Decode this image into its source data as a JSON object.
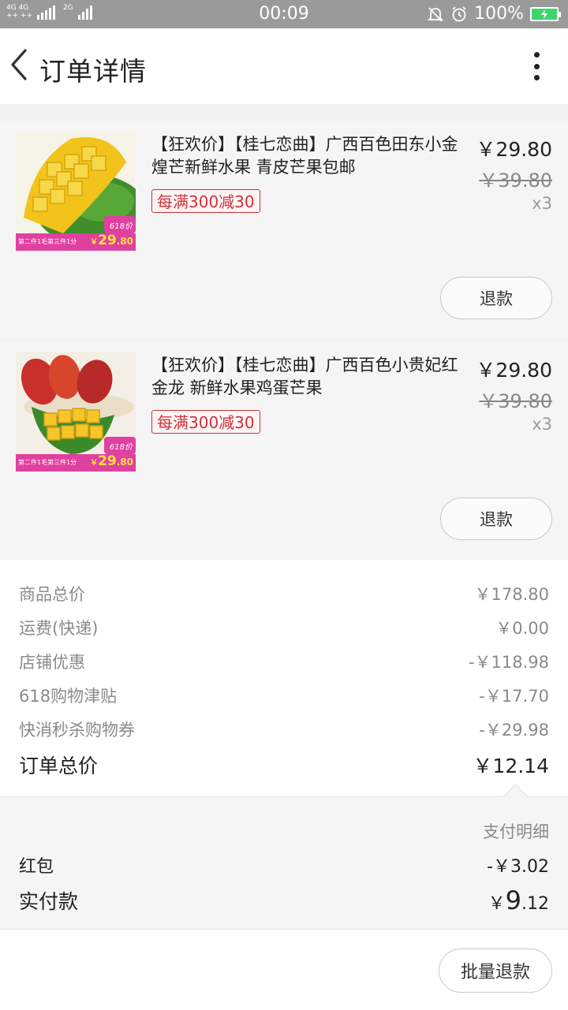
{
  "status_bar": {
    "network_left": "4G 4G",
    "network_left_sub": "++ ++",
    "network_right": "2G",
    "time": "00:09",
    "battery": "100%"
  },
  "header": {
    "title": "订单详情",
    "back_icon": "chevron-left-icon",
    "more_icon": "more-vertical-icon"
  },
  "products": [
    {
      "title": "【狂欢价】【桂七恋曲】广西百色田东小金煌芒新鲜水果 青皮芒果包邮",
      "promo": "每满300减30",
      "price": "￥29.80",
      "original_price": "￥39.80",
      "quantity": "x3",
      "refund_label": "退款",
      "thumb": {
        "badge": "618价",
        "banner": "第二件1毛第三件1分",
        "banner_price_cur": "￥",
        "banner_price_int": "29",
        "banner_price_dec": ".80"
      }
    },
    {
      "title": "【狂欢价】【桂七恋曲】广西百色小贵妃红金龙 新鲜水果鸡蛋芒果",
      "promo": "每满300减30",
      "price": "￥29.80",
      "original_price": "￥39.80",
      "quantity": "x3",
      "refund_label": "退款",
      "thumb": {
        "badge": "618价",
        "banner": "第二件1毛第三件1分",
        "banner_price_cur": "￥",
        "banner_price_int": "29",
        "banner_price_dec": ".80"
      }
    }
  ],
  "summary": [
    {
      "label": "商品总价",
      "value": "￥178.80"
    },
    {
      "label": "运费(快递)",
      "value": "￥0.00"
    },
    {
      "label": "店铺优惠",
      "value": "-￥118.98"
    },
    {
      "label": "618购物津贴",
      "value": "-￥17.70"
    },
    {
      "label": "快消秒杀购物券",
      "value": "-￥29.98"
    }
  ],
  "order_total": {
    "label": "订单总价",
    "value": "￥12.14"
  },
  "payment": {
    "detail_link": "支付明细",
    "red_packet_label": "红包",
    "red_packet_value": "-￥3.02",
    "actual_label": "实付款",
    "actual_cur": "￥",
    "actual_int": "9",
    "actual_dec": ".12"
  },
  "batch_refund_label": "批量退款",
  "colors": {
    "accent_orange": "#ec6118",
    "promo_red": "#d0313a",
    "status_bar": "#9a9a9a",
    "battery_green": "#3ed46b"
  }
}
